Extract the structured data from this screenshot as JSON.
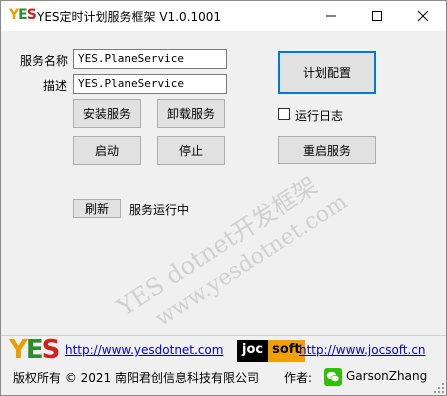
{
  "titlebar": {
    "logo": "YES",
    "title": "YES定时计划服务框架 V1.0.1001",
    "minimize_glyph": "—",
    "maximize_glyph": "☐",
    "close_glyph": "✕"
  },
  "form": {
    "service_name_label": "服务名称",
    "service_name_value": "YES.PlaneService",
    "description_label": "描述",
    "description_value": "YES.PlaneService"
  },
  "buttons": {
    "install": "安装服务",
    "uninstall": "卸载服务",
    "start": "启动",
    "stop": "停止",
    "schedule_config": "计划配置",
    "restart_service": "重启服务",
    "refresh": "刷新"
  },
  "options": {
    "run_log_label": "运行日志",
    "run_log_checked": false
  },
  "status": {
    "text": "服务运行中"
  },
  "watermark": {
    "line1": "YES dotnet开发框架",
    "line2": "www.yesdotnet.com"
  },
  "footer": {
    "yes_logo": "YES",
    "yes_link": "http://www.yesdotnet.com",
    "joc_logo_part1": "joc",
    "joc_logo_part2": "soft",
    "joc_link": "http://www.jocsoft.cn",
    "copyright": "版权所有 © 2021 南阳君创信息科技有限公司",
    "author_label": "作者:",
    "author_name": "GarsonZhang"
  },
  "colors": {
    "accent": "#0078d7",
    "link": "#0000cc",
    "logo_y": "#e8a000",
    "logo_e": "#2e8b2e",
    "logo_s": "#d02020",
    "joc_orange": "#f0a000"
  },
  "icons": {
    "wechat": "wechat-icon",
    "resize_grip": "resize-grip-icon"
  }
}
